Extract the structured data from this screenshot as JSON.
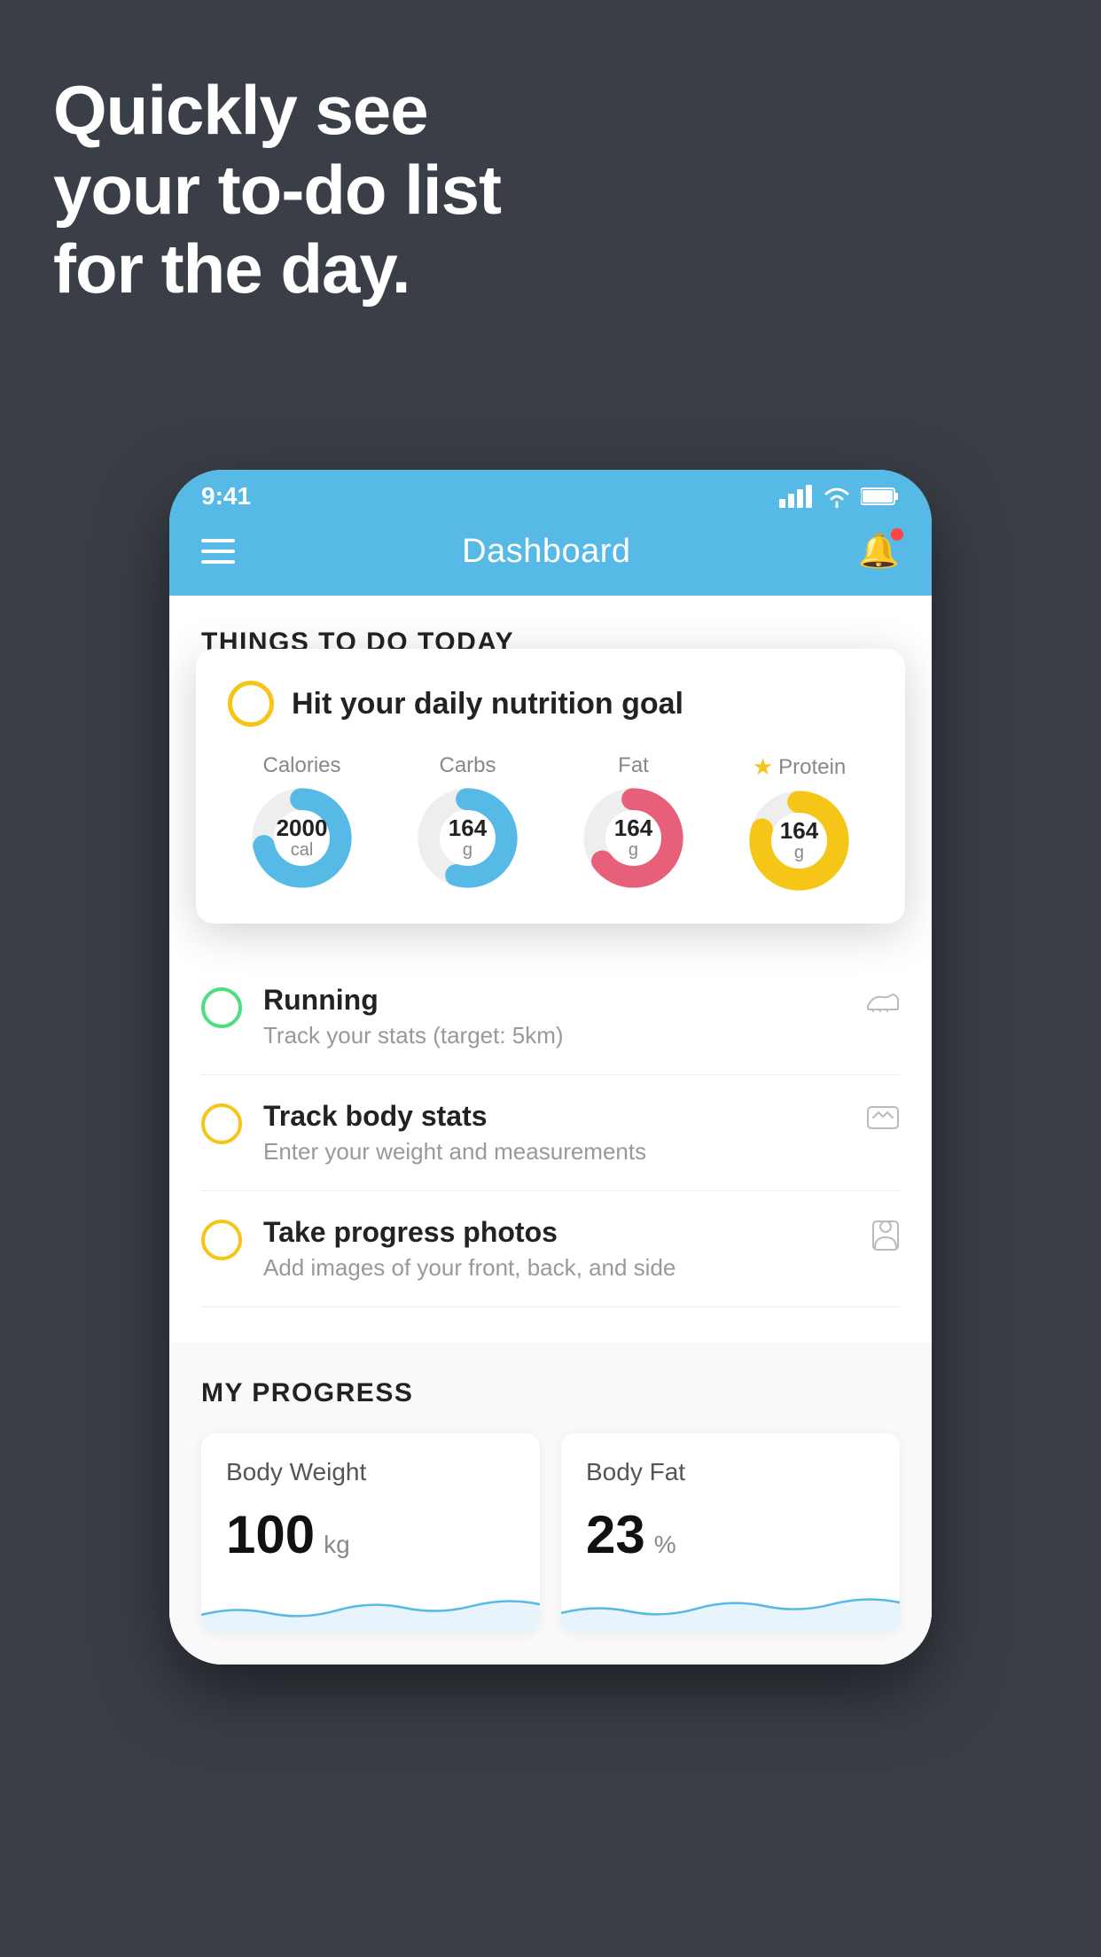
{
  "headline": {
    "line1": "Quickly see",
    "line2": "your to-do list",
    "line3": "for the day."
  },
  "status_bar": {
    "time": "9:41",
    "signal": "▋▋▋▋",
    "wifi": "wifi",
    "battery": "battery"
  },
  "nav": {
    "title": "Dashboard"
  },
  "things_header": "THINGS TO DO TODAY",
  "floating_card": {
    "title": "Hit your daily nutrition goal",
    "nutrients": [
      {
        "label": "Calories",
        "value": "2000",
        "unit": "cal",
        "color": "#56b9e6",
        "percent": 72,
        "star": false
      },
      {
        "label": "Carbs",
        "value": "164",
        "unit": "g",
        "color": "#56b9e6",
        "percent": 55,
        "star": false
      },
      {
        "label": "Fat",
        "value": "164",
        "unit": "g",
        "color": "#e85f7a",
        "percent": 65,
        "star": false
      },
      {
        "label": "Protein",
        "value": "164",
        "unit": "g",
        "color": "#f5c518",
        "percent": 80,
        "star": true
      }
    ]
  },
  "list_items": [
    {
      "title": "Running",
      "subtitle": "Track your stats (target: 5km)",
      "circle_color": "green",
      "icon": "shoe"
    },
    {
      "title": "Track body stats",
      "subtitle": "Enter your weight and measurements",
      "circle_color": "yellow",
      "icon": "scale"
    },
    {
      "title": "Take progress photos",
      "subtitle": "Add images of your front, back, and side",
      "circle_color": "yellow",
      "icon": "person"
    }
  ],
  "progress": {
    "header": "MY PROGRESS",
    "cards": [
      {
        "title": "Body Weight",
        "value": "100",
        "unit": "kg"
      },
      {
        "title": "Body Fat",
        "value": "23",
        "unit": "%"
      }
    ]
  }
}
